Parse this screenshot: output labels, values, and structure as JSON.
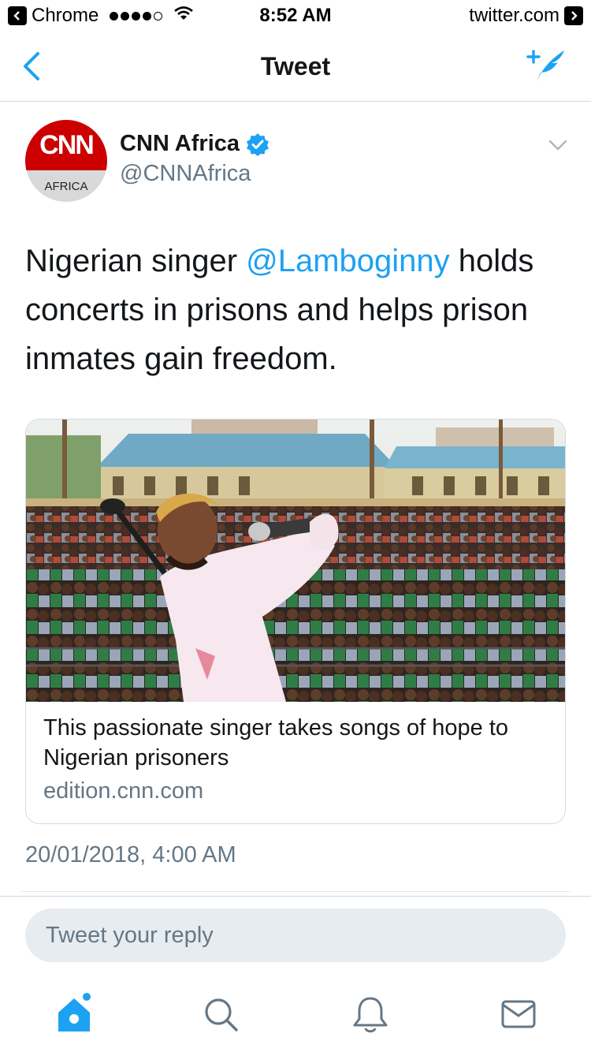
{
  "status_bar": {
    "app_name": "Chrome",
    "time": "8:52 AM",
    "site": "twitter.com"
  },
  "nav": {
    "title": "Tweet"
  },
  "tweet": {
    "author_name": "CNN Africa",
    "author_handle": "@CNNAfrica",
    "avatar_logo_text": "CNN",
    "avatar_sub_text": "AFRICA",
    "text_before_mention": "Nigerian singer ",
    "mention": "@Lamboginny",
    "text_after_mention": " holds concerts in prisons and helps prison inmates gain freedom.",
    "timestamp": "20/01/2018, 4:00 AM"
  },
  "card": {
    "title": "This passionate singer takes songs of hope to Nigerian prisoners",
    "domain": "edition.cnn.com"
  },
  "reply": {
    "placeholder": "Tweet your reply"
  },
  "colors": {
    "accent": "#1da1f2",
    "secondary_text": "#657786",
    "cnn_red": "#cc0000",
    "tab_icon": "#657786"
  },
  "icons": {
    "back": "chevron-left-icon",
    "compose": "compose-tweet-icon",
    "verified": "verified-badge-icon",
    "menu": "chevron-down-icon",
    "tabs": [
      "home-icon",
      "search-icon",
      "notifications-icon",
      "messages-icon"
    ]
  }
}
